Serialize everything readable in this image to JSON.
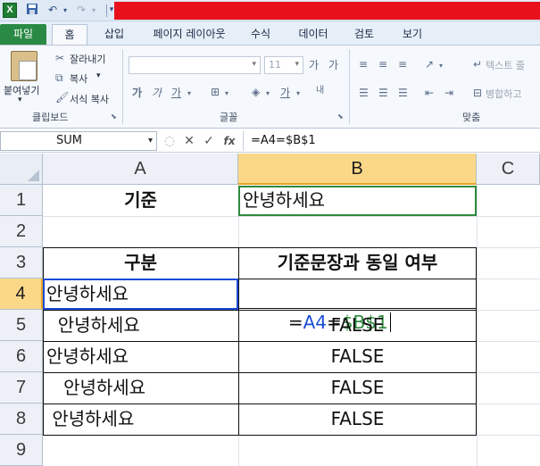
{
  "titlebar": {
    "logo": "X"
  },
  "tabs": [
    "파일",
    "홈",
    "삽입",
    "페이지 레이아웃",
    "수식",
    "데이터",
    "검토",
    "보기"
  ],
  "clipboard": {
    "paste": "붙여넣기",
    "cut": "잘라내기",
    "copy": "복사",
    "format_painter": "서식 복사",
    "label": "클립보드"
  },
  "font": {
    "size": "11",
    "label": "글꼴"
  },
  "alignment": {
    "wrap_text": "텍스트 줄",
    "merge": "병합하고",
    "label": "맞춤"
  },
  "formula_bar": {
    "name_box": "SUM",
    "fx": "fx",
    "formula": "=A4=$B$1"
  },
  "columns": [
    "A",
    "B",
    "C"
  ],
  "rows": [
    "1",
    "2",
    "3",
    "4",
    "5",
    "6",
    "7",
    "8",
    "9"
  ],
  "cells": {
    "A1": "기준",
    "B1": "안녕하세요",
    "A3": "구분",
    "B3": "기준문장과 동일 여부",
    "A4": "안녕하세요",
    "A5": "  안녕하세요",
    "A6": "안녕하세요 ",
    "A7": "   안녕하세요",
    "A8": " 안녕하세요",
    "B5": "FALSE",
    "B6": "FALSE",
    "B7": "FALSE",
    "B8": "FALSE"
  },
  "editing": {
    "eq": "=",
    "ref_a4": "A4",
    "op": "=",
    "ref_b1": "$B$1"
  },
  "colors": {
    "ref_blue": "#1a4bd6",
    "ref_green": "#2e8a3d",
    "active_header": "#fbd888",
    "title_red": "#e8101b",
    "file_tab": "#2a8a45"
  }
}
